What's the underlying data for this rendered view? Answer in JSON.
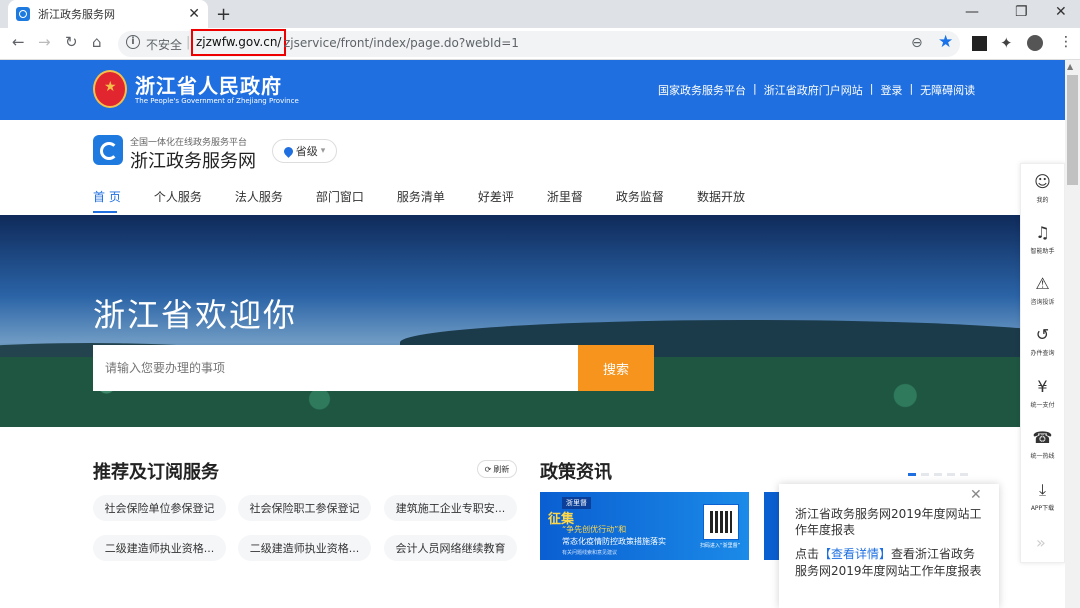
{
  "browser": {
    "tab_title": "浙江政务服务网",
    "tab_close": "✕",
    "new_tab": "+",
    "insecure_label": "不安全",
    "url_host": "zjzwfw.gov.cn/",
    "url_path": "zjservice/front/index/page.do?webId=1",
    "controls": {
      "minimize": "—",
      "maximize": "❐",
      "close": "✕"
    },
    "nav": {
      "back": "←",
      "forward": "→",
      "reload": "↻",
      "home": "⌂",
      "zoom": "⊖",
      "star": "★",
      "menu": "⋮",
      "puzzle": "✦"
    }
  },
  "gov_header": {
    "title": "浙江省人民政府",
    "subtitle": "The People's Government of Zhejiang Province",
    "links": [
      "国家政务服务平台",
      "|",
      "浙江省政府门户网站",
      "|",
      "登录",
      "|",
      "无障碍阅读"
    ]
  },
  "brand": {
    "tagline": "全国一体化在线政务服务平台",
    "name": "浙江政务服务网",
    "region": "省级",
    "region_caret": "▾"
  },
  "nav": {
    "items": [
      "首 页",
      "个人服务",
      "法人服务",
      "部门窗口",
      "服务清单",
      "好差评",
      "浙里督",
      "政务监督",
      "数据开放"
    ],
    "active": 0
  },
  "hero": {
    "title": "浙江省欢迎你",
    "search_placeholder": "请输入您要办理的事项",
    "search_button": "搜索"
  },
  "recommend": {
    "title": "推荐及订阅服务",
    "refresh": "刷新",
    "refresh_icon": "⟳",
    "chips": [
      "社会保险单位参保登记",
      "社会保险职工参保登记",
      "建筑施工企业专职安...",
      "二级建造师执业资格...",
      "二级建造师执业资格...",
      "会计人员网络继续教育"
    ]
  },
  "policy": {
    "title": "政策资讯",
    "banner": {
      "tag": "浙里督",
      "headline": "征集",
      "line1": "“争先创优行动”和",
      "line2": "常态化疫情防控政策措施落实",
      "small": "有关问题线索和意见建议",
      "qr_caption": "扫码进入“浙里督”"
    }
  },
  "popup": {
    "close": "✕",
    "title": "浙江省政务服务网2019年度网站工作年度报表",
    "body_prefix": "点击",
    "link": "【查看详情】",
    "body_suffix": "查看浙江省政务服务网2019年度网站工作年度报表"
  },
  "sidebar": {
    "items": [
      {
        "icon": "user-icon",
        "glyph": "☺",
        "label": "我的"
      },
      {
        "icon": "headset-icon",
        "glyph": "♫",
        "label": "智能助手"
      },
      {
        "icon": "alert-shield-icon",
        "glyph": "⚠",
        "label": "咨询投诉"
      },
      {
        "icon": "history-icon",
        "glyph": "↺",
        "label": "办件查询"
      },
      {
        "icon": "yen-icon",
        "glyph": "¥",
        "label": "统一支付"
      },
      {
        "icon": "phone-icon",
        "glyph": "☎",
        "label": "统一热线"
      },
      {
        "icon": "download-icon",
        "glyph": "⤓",
        "label": "APP下载"
      }
    ],
    "more": "»"
  },
  "colors": {
    "brand_blue": "#1f6fe0",
    "search_orange": "#f7941d",
    "url_highlight": "#e00000"
  }
}
